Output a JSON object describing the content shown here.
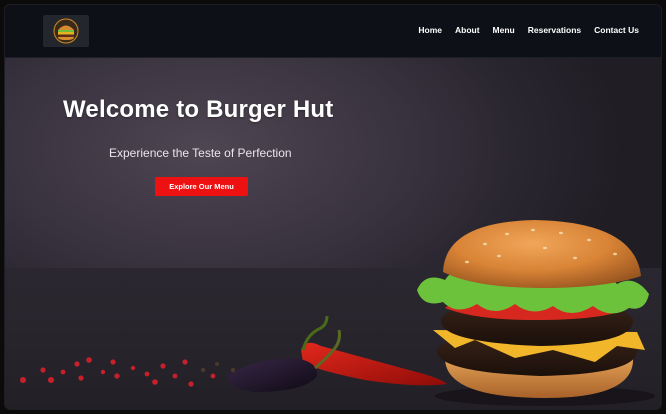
{
  "brand": {
    "logo_icon": "burger-logo-icon"
  },
  "nav": {
    "items": [
      {
        "label": "Home"
      },
      {
        "label": "About"
      },
      {
        "label": "Menu"
      },
      {
        "label": "Reservations"
      },
      {
        "label": "Contact Us"
      }
    ]
  },
  "hero": {
    "title": "Welcome to Burger Hut",
    "subtitle": "Experience the Teste of Perfection",
    "cta_label": "Explore Our Menu",
    "accent_color": "#ee1111"
  }
}
